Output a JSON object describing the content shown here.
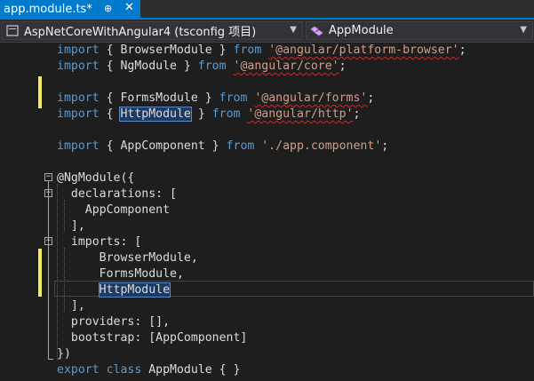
{
  "tab": {
    "title": "app.module.ts*",
    "pin": "⊕",
    "close": "✕"
  },
  "navbar": {
    "project": "AspNetCoreWithAngular4 (tsconfig 项目)",
    "class": "AppModule"
  },
  "colors": {
    "accent": "#007acc",
    "keyword": "#569cd6",
    "string": "#d69d85",
    "modified": "#efef60"
  },
  "code_lines": [
    [
      "import",
      " { BrowserModule } ",
      "from",
      " ",
      "'@angular/platform-browser'",
      ";"
    ],
    [
      "import",
      " { NgModule } ",
      "from",
      " ",
      "'@angular/core'",
      ";"
    ],
    [
      "import",
      " { FormsModule } ",
      "from",
      " ",
      "'@angular/forms'",
      ";"
    ],
    [
      "import",
      " { ",
      "HttpModule",
      " } ",
      "from",
      " ",
      "'@angular/http'",
      ";"
    ],
    [
      "import",
      " { AppComponent } ",
      "from",
      " ",
      "'./app.component'",
      ";"
    ],
    "@NgModule({",
    "  declarations: [",
    "    AppComponent",
    "  ],",
    "  imports: [",
    "      BrowserModule,",
    "      FormsModule,",
    "      HttpModule",
    "  ],",
    "  providers: [],",
    "  bootstrap: [AppComponent]",
    "})",
    [
      "export",
      " ",
      "class",
      " AppModule { }"
    ]
  ]
}
